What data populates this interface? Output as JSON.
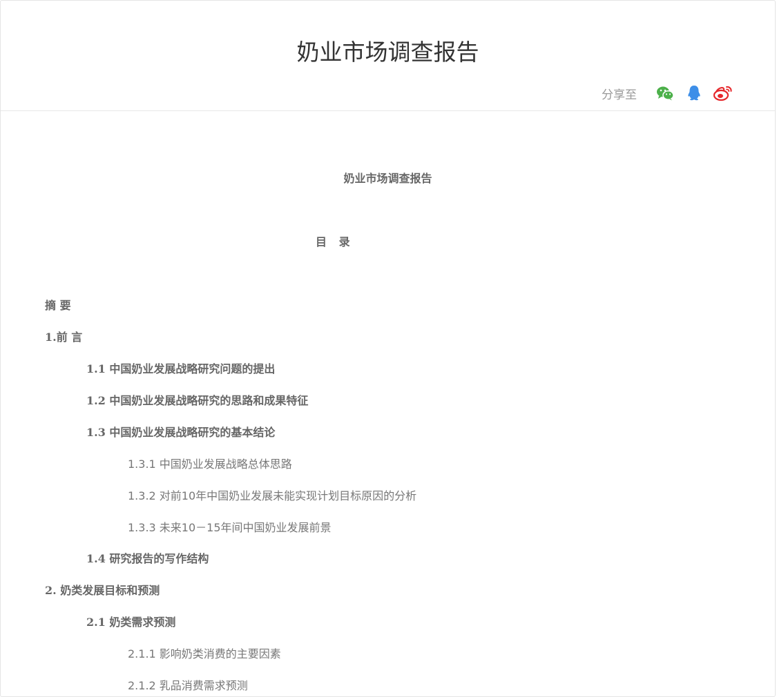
{
  "header": {
    "title": "奶业市场调查报告",
    "share_label": "分享至",
    "share_icons": [
      "wechat-icon",
      "qq-icon",
      "weibo-icon"
    ]
  },
  "document": {
    "title": "奶业市场调查报告",
    "toc_heading": "目 录",
    "toc": [
      {
        "text": "摘 要",
        "level": 0
      },
      {
        "text": "1.前 言",
        "level": 0
      },
      {
        "text": "1.1 中国奶业发展战略研究问题的提出",
        "level": 1
      },
      {
        "text": "1.2 中国奶业发展战略研究的思路和成果特征",
        "level": 1
      },
      {
        "text": "1.3 中国奶业发展战略研究的基本结论",
        "level": 1
      },
      {
        "text": "1.3.1 中国奶业发展战略总体思路",
        "level": 2
      },
      {
        "text": "1.3.2 对前10年中国奶业发展未能实现计划目标原因的分析",
        "level": 2
      },
      {
        "text": "1.3.3 未来10－15年间中国奶业发展前景",
        "level": 2
      },
      {
        "text": "1.4 研究报告的写作结构",
        "level": 1
      },
      {
        "text": "2. 奶类发展目标和预测",
        "level": 0
      },
      {
        "text": "2.1 奶类需求预测",
        "level": 1
      },
      {
        "text": "2.1.1 影响奶类消费的主要因素",
        "level": 2
      },
      {
        "text": "2.1.2 乳品消费需求预测",
        "level": 2
      }
    ]
  },
  "colors": {
    "wechat": "#4cb04a",
    "qq": "#3d8ee8",
    "weibo": "#e6282c"
  }
}
